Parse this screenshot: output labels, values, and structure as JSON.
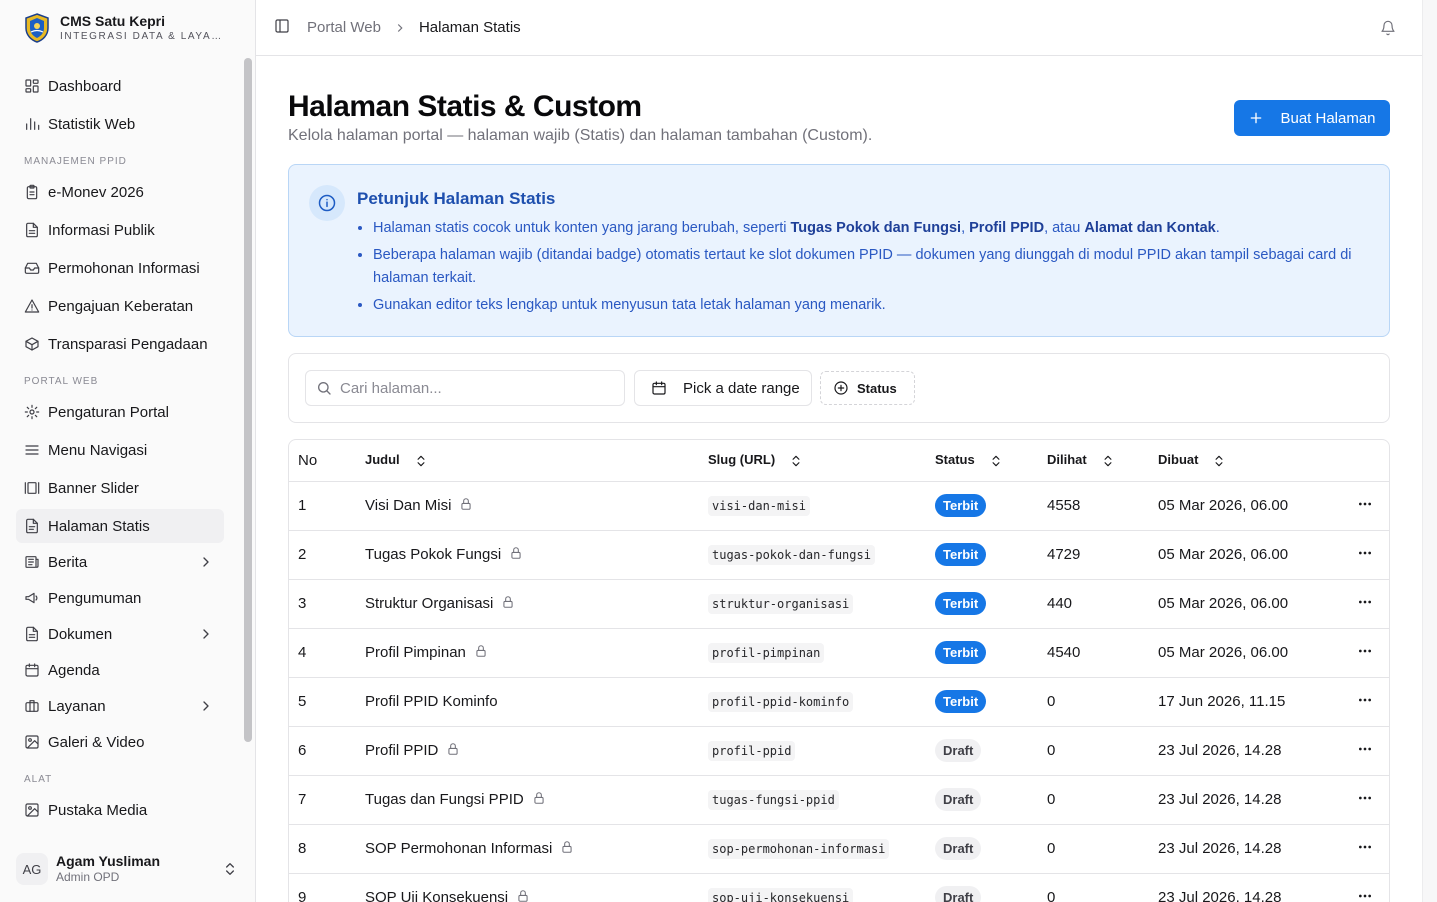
{
  "app": {
    "title": "CMS Satu Kepri",
    "subtitle": "INTEGRASI DATA & LAYANAN PUBLIK"
  },
  "sidebar": {
    "items_top": [
      {
        "label": "Dashboard",
        "icon": "dashboard-icon"
      },
      {
        "label": "Statistik Web",
        "icon": "bar-chart-icon"
      }
    ],
    "group_ppid": "MANAJEMEN PPID",
    "items_ppid": [
      {
        "label": "e-Monev 2026",
        "icon": "clipboard-icon"
      },
      {
        "label": "Informasi Publik",
        "icon": "file-text-icon"
      },
      {
        "label": "Permohonan Informasi",
        "icon": "inbox-icon"
      },
      {
        "label": "Pengajuan Keberatan",
        "icon": "alert-triangle-icon"
      },
      {
        "label": "Transparasi Pengadaan",
        "icon": "package-icon"
      }
    ],
    "group_portal": "PORTAL WEB",
    "items_portal": [
      {
        "label": "Pengaturan Portal",
        "icon": "gear-icon"
      },
      {
        "label": "Menu Navigasi",
        "icon": "menu-icon"
      },
      {
        "label": "Banner Slider",
        "icon": "gallery-horizontal-icon"
      },
      {
        "label": "Halaman Statis",
        "icon": "file-icon"
      },
      {
        "label": "Berita",
        "icon": "newspaper-icon"
      },
      {
        "label": "Pengumuman",
        "icon": "megaphone-icon"
      },
      {
        "label": "Dokumen",
        "icon": "document-icon"
      },
      {
        "label": "Agenda",
        "icon": "calendar-icon"
      },
      {
        "label": "Layanan",
        "icon": "briefcase-icon"
      },
      {
        "label": "Galeri & Video",
        "icon": "image-icon"
      }
    ],
    "group_tools": "ALAT",
    "items_tools": [
      {
        "label": "Pustaka Media",
        "icon": "image-icon"
      }
    ]
  },
  "user": {
    "initials": "AG",
    "name": "Agam Yusliman",
    "role": "Admin OPD"
  },
  "header": {
    "breadcrumb_parent": "Portal Web",
    "breadcrumb_current": "Halaman Statis"
  },
  "page": {
    "title": "Halaman Statis & Custom",
    "subtitle": "Kelola halaman portal — halaman wajib (Statis) dan halaman tambahan (Custom).",
    "create_button": "Buat Halaman"
  },
  "notice": {
    "title": "Petunjuk Halaman Statis",
    "b1_pre": "Halaman statis cocok untuk konten yang jarang berubah, seperti ",
    "b1_k1": "Tugas Pokok dan Fungsi",
    "b1_sep": ", ",
    "b1_k2": "Profil PPID",
    "b1_mid": ", atau ",
    "b1_k3": "Alamat dan Kontak",
    "b1_end": ".",
    "b2": "Beberapa halaman wajib (ditandai badge) otomatis tertaut ke slot dokumen PPID — dokumen yang diunggah di modul PPID akan tampil sebagai card di halaman terkait.",
    "b3": "Gunakan editor teks lengkap untuk menyusun tata letak halaman yang menarik."
  },
  "filters": {
    "search_placeholder": "Cari halaman...",
    "date_label": "Pick a date range",
    "status_label": "Status"
  },
  "table": {
    "headers": {
      "no": "No",
      "title": "Judul",
      "slug": "Slug (URL)",
      "status": "Status",
      "views": "Dilihat",
      "created": "Dibuat"
    },
    "rows": [
      {
        "no": "1",
        "title": "Visi Dan Misi",
        "locked": true,
        "slug": "visi-dan-misi",
        "status": "Terbit",
        "views": "4558",
        "created": "05 Mar 2026, 06.00"
      },
      {
        "no": "2",
        "title": "Tugas Pokok Fungsi",
        "locked": true,
        "slug": "tugas-pokok-dan-fungsi",
        "status": "Terbit",
        "views": "4729",
        "created": "05 Mar 2026, 06.00"
      },
      {
        "no": "3",
        "title": "Struktur Organisasi",
        "locked": true,
        "slug": "struktur-organisasi",
        "status": "Terbit",
        "views": "440",
        "created": "05 Mar 2026, 06.00"
      },
      {
        "no": "4",
        "title": "Profil Pimpinan",
        "locked": true,
        "slug": "profil-pimpinan",
        "status": "Terbit",
        "views": "4540",
        "created": "05 Mar 2026, 06.00"
      },
      {
        "no": "5",
        "title": "Profil PPID Kominfo",
        "locked": false,
        "slug": "profil-ppid-kominfo",
        "status": "Terbit",
        "views": "0",
        "created": "17 Jun 2026, 11.15"
      },
      {
        "no": "6",
        "title": "Profil PPID",
        "locked": true,
        "slug": "profil-ppid",
        "status": "Draft",
        "views": "0",
        "created": "23 Jul 2026, 14.28"
      },
      {
        "no": "7",
        "title": "Tugas dan Fungsi PPID",
        "locked": true,
        "slug": "tugas-fungsi-ppid",
        "status": "Draft",
        "views": "0",
        "created": "23 Jul 2026, 14.28"
      },
      {
        "no": "8",
        "title": "SOP Permohonan Informasi",
        "locked": true,
        "slug": "sop-permohonan-informasi",
        "status": "Draft",
        "views": "0",
        "created": "23 Jul 2026, 14.28"
      },
      {
        "no": "9",
        "title": "SOP Uji Konsekuensi",
        "locked": true,
        "slug": "sop-uji-konsekuensi",
        "status": "Draft",
        "views": "0",
        "created": "23 Jul 2026, 14.28"
      }
    ]
  },
  "colors": {
    "primary": "#1677e6",
    "notice_bg": "#eaf3fe",
    "notice_text": "#2a58c2"
  }
}
